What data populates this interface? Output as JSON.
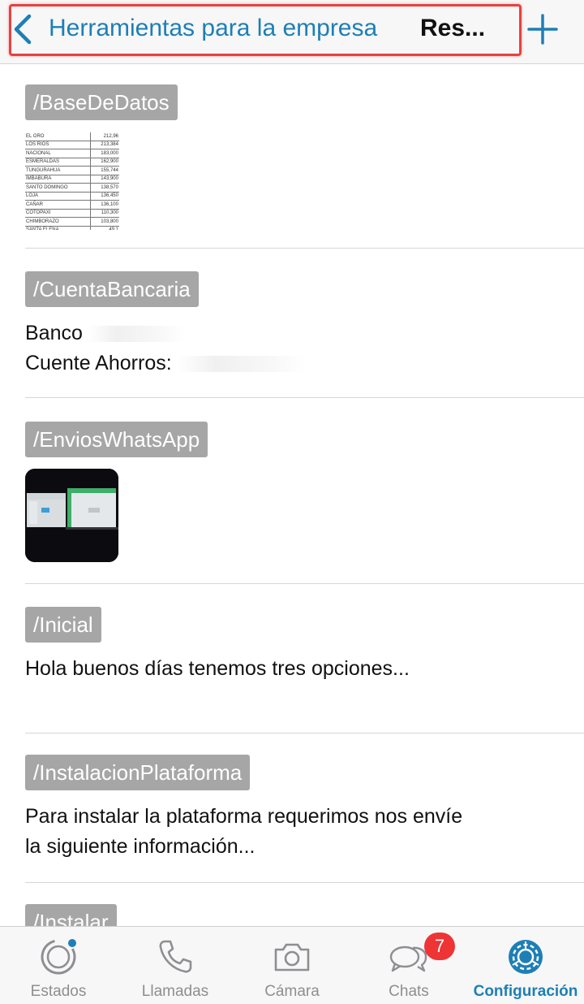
{
  "navbar": {
    "back_label": "Herramientas para la empresa",
    "title": "Res..."
  },
  "items": [
    {
      "tag": "/BaseDeDatos",
      "thumbnail": {
        "rows": [
          [
            "EL ORO",
            "212,96"
          ],
          [
            "LOS RIOS",
            "213,384"
          ],
          [
            "NACIONAL",
            "183,000"
          ],
          [
            "ESMERALDAS",
            "162,900"
          ],
          [
            "TUNGURAHUA",
            "155,744"
          ],
          [
            "IMBABURA",
            "143,900"
          ],
          [
            "SANTO DOMINGO",
            "138,570"
          ],
          [
            "LOJA",
            "136,450"
          ],
          [
            "CAÑAR",
            "136,100"
          ],
          [
            "COTOPAXI",
            "110,300"
          ],
          [
            "CHIMBORAZO",
            "103,800"
          ],
          [
            "SANTA ELENA",
            "49,1"
          ]
        ]
      }
    },
    {
      "tag": "/CuentaBancaria",
      "lines": [
        "Banco",
        "Cuente Ahorros:"
      ]
    },
    {
      "tag": "/EnviosWhatsApp"
    },
    {
      "tag": "/Inicial",
      "lines": [
        "Hola buenos días tenemos tres opciones..."
      ]
    },
    {
      "tag": "/InstalacionPlataforma",
      "lines": [
        "Para instalar la plataforma requerimos nos envíe",
        "la siguiente información..."
      ]
    },
    {
      "tag": "/Instalar"
    }
  ],
  "tabbar": {
    "tabs": [
      {
        "label": "Estados",
        "icon": "status-icon"
      },
      {
        "label": "Llamadas",
        "icon": "phone-icon"
      },
      {
        "label": "Cámara",
        "icon": "camera-icon"
      },
      {
        "label": "Chats",
        "icon": "chat-bubbles-icon"
      },
      {
        "label": "Configuración",
        "icon": "settings-gear-icon"
      }
    ],
    "chats_badge": "7"
  },
  "colors": {
    "accent": "#1d7fb5",
    "tag_background": "#a6a6a6",
    "highlight_border": "#e8413f",
    "badge": "#ee3434"
  }
}
